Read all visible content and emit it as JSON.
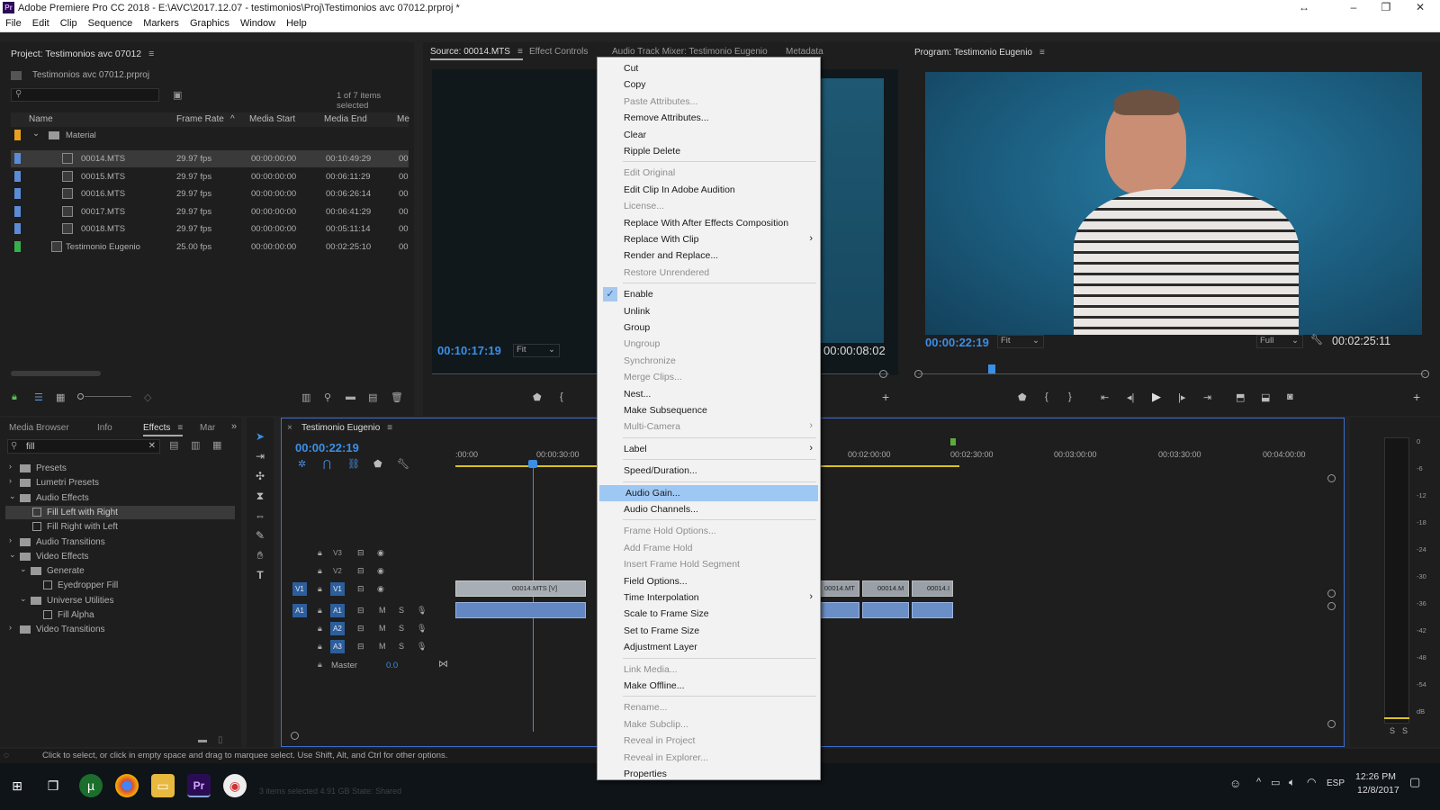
{
  "window": {
    "title": "Adobe Premiere Pro CC 2018 - E:\\AVC\\2017.12.07 - testimonios\\Proj\\Testimonios avc 07012.prproj *"
  },
  "menubar": [
    "File",
    "Edit",
    "Clip",
    "Sequence",
    "Markers",
    "Graphics",
    "Window",
    "Help"
  ],
  "project": {
    "title": "Project: Testimonios avc 07012",
    "file": "Testimonios avc 07012.prproj",
    "selection": "1 of 7 items selected",
    "columns": [
      "Name",
      "Frame Rate",
      "Media Start",
      "Media End",
      "Me"
    ],
    "bin": "Material",
    "rows": [
      {
        "name": "00014.MTS",
        "fps": "29.97 fps",
        "start": "00:00:00:00",
        "end": "00:10:49:29",
        "me": "00",
        "color": "#5d8cd6"
      },
      {
        "name": "00015.MTS",
        "fps": "29.97 fps",
        "start": "00:00:00:00",
        "end": "00:06:11:29",
        "me": "00",
        "color": "#5d8cd6"
      },
      {
        "name": "00016.MTS",
        "fps": "29.97 fps",
        "start": "00:00:00:00",
        "end": "00:06:26:14",
        "me": "00",
        "color": "#5d8cd6"
      },
      {
        "name": "00017.MTS",
        "fps": "29.97 fps",
        "start": "00:00:00:00",
        "end": "00:06:41:29",
        "me": "00",
        "color": "#5d8cd6"
      },
      {
        "name": "00018.MTS",
        "fps": "29.97 fps",
        "start": "00:00:00:00",
        "end": "00:05:11:14",
        "me": "00",
        "color": "#5d8cd6"
      },
      {
        "name": "Testimonio Eugenio",
        "fps": "25.00 fps",
        "start": "00:00:00:00",
        "end": "00:02:25:10",
        "me": "00",
        "color": "#36b04a"
      }
    ]
  },
  "source": {
    "tabs": [
      "Source: 00014.MTS",
      "Effect Controls",
      "Audio Track Mixer: Testimonio Eugenio",
      "Metadata"
    ],
    "timecode": "00:10:17:19",
    "fit": "Fit",
    "duration": "00:00:08:02"
  },
  "program": {
    "title": "Program: Testimonio Eugenio",
    "timecode": "00:00:22:19",
    "fit": "Fit",
    "quality": "Full",
    "duration": "00:02:25:11"
  },
  "effects": {
    "tabs": [
      "Media Browser",
      "Info",
      "Effects",
      "Mar"
    ],
    "search": "fill",
    "tree": [
      {
        "label": "Presets",
        "level": 0,
        "type": "folder"
      },
      {
        "label": "Lumetri Presets",
        "level": 0,
        "type": "folder"
      },
      {
        "label": "Audio Effects",
        "level": 0,
        "type": "folder"
      },
      {
        "label": "Fill Left with Right",
        "level": 1,
        "type": "fx"
      },
      {
        "label": "Fill Right with Left",
        "level": 1,
        "type": "fx"
      },
      {
        "label": "Audio Transitions",
        "level": 0,
        "type": "folder"
      },
      {
        "label": "Video Effects",
        "level": 0,
        "type": "folder"
      },
      {
        "label": "Generate",
        "level": 1,
        "type": "folder"
      },
      {
        "label": "Eyedropper Fill",
        "level": 2,
        "type": "fx"
      },
      {
        "label": "Universe Utilities",
        "level": 1,
        "type": "folder"
      },
      {
        "label": "Fill Alpha",
        "level": 2,
        "type": "fx"
      },
      {
        "label": "Video Transitions",
        "level": 0,
        "type": "folder"
      }
    ]
  },
  "timeline": {
    "title": "Testimonio Eugenio",
    "timecode": "00:00:22:19",
    "ruler": [
      ":00:00",
      "00:00:30:00",
      "00:02:00:00",
      "00:02:30:00",
      "00:03:00:00",
      "00:03:30:00",
      "00:04:00:00"
    ],
    "tracks": [
      {
        "name": "V3",
        "kind": "video"
      },
      {
        "name": "V2",
        "kind": "video"
      },
      {
        "name": "V1",
        "kind": "video"
      },
      {
        "name": "A1",
        "kind": "audio"
      },
      {
        "name": "A2",
        "kind": "audio"
      },
      {
        "name": "A3",
        "kind": "audio"
      }
    ],
    "master": "Master",
    "master_value": "0.0",
    "clips": [
      "00014.MTS [V]",
      "00014.MT",
      "00014.M",
      "00014.I"
    ],
    "mute_label": "M",
    "solo_label": "S"
  },
  "meter": {
    "labels": [
      "0",
      "-6",
      "-12",
      "-18",
      "-24",
      "-30",
      "-36",
      "-42",
      "-48",
      "-54",
      "dB"
    ],
    "buttons": [
      "S",
      "S"
    ]
  },
  "status": "Click to select, or click in empty space and drag to marquee select. Use Shift, Alt, and Ctrl for other options.",
  "taskbar": {
    "time": "12:26 PM",
    "date": "12/8/2017",
    "lang": "ESP",
    "ghost": "3 items selected  4.91 GB     State:   Shared"
  },
  "context_menu": [
    {
      "label": "Cut",
      "enabled": true
    },
    {
      "label": "Copy",
      "enabled": true
    },
    {
      "label": "Paste Attributes...",
      "enabled": false
    },
    {
      "label": "Remove Attributes...",
      "enabled": true
    },
    {
      "label": "Clear",
      "enabled": true
    },
    {
      "label": "Ripple Delete",
      "enabled": true
    },
    {
      "sep": true
    },
    {
      "label": "Edit Original",
      "enabled": false
    },
    {
      "label": "Edit Clip In Adobe Audition",
      "enabled": true
    },
    {
      "label": "License...",
      "enabled": false
    },
    {
      "label": "Replace With After Effects Composition",
      "enabled": true
    },
    {
      "label": "Replace With Clip",
      "enabled": true,
      "sub": true
    },
    {
      "label": "Render and Replace...",
      "enabled": true
    },
    {
      "label": "Restore Unrendered",
      "enabled": false
    },
    {
      "sep": true
    },
    {
      "label": "Enable",
      "enabled": true,
      "checked": true
    },
    {
      "label": "Unlink",
      "enabled": true
    },
    {
      "label": "Group",
      "enabled": true
    },
    {
      "label": "Ungroup",
      "enabled": false
    },
    {
      "label": "Synchronize",
      "enabled": false
    },
    {
      "label": "Merge Clips...",
      "enabled": false
    },
    {
      "label": "Nest...",
      "enabled": true
    },
    {
      "label": "Make Subsequence",
      "enabled": true
    },
    {
      "label": "Multi-Camera",
      "enabled": false,
      "sub": true
    },
    {
      "sep": true
    },
    {
      "label": "Label",
      "enabled": true,
      "sub": true
    },
    {
      "sep": true
    },
    {
      "label": "Speed/Duration...",
      "enabled": true
    },
    {
      "sep": true
    },
    {
      "label": "Audio Gain...",
      "enabled": true,
      "highlight": true
    },
    {
      "label": "Audio Channels...",
      "enabled": true
    },
    {
      "sep": true
    },
    {
      "label": "Frame Hold Options...",
      "enabled": false
    },
    {
      "label": "Add Frame Hold",
      "enabled": false
    },
    {
      "label": "Insert Frame Hold Segment",
      "enabled": false
    },
    {
      "label": "Field Options...",
      "enabled": true
    },
    {
      "label": "Time Interpolation",
      "enabled": true,
      "sub": true
    },
    {
      "label": "Scale to Frame Size",
      "enabled": true
    },
    {
      "label": "Set to Frame Size",
      "enabled": true
    },
    {
      "label": "Adjustment Layer",
      "enabled": true
    },
    {
      "sep": true
    },
    {
      "label": "Link Media...",
      "enabled": false
    },
    {
      "label": "Make Offline...",
      "enabled": true
    },
    {
      "sep": true
    },
    {
      "label": "Rename...",
      "enabled": false
    },
    {
      "label": "Make Subclip...",
      "enabled": false
    },
    {
      "label": "Reveal in Project",
      "enabled": false
    },
    {
      "label": "Reveal in Explorer...",
      "enabled": false
    },
    {
      "label": "Properties",
      "enabled": true
    }
  ]
}
